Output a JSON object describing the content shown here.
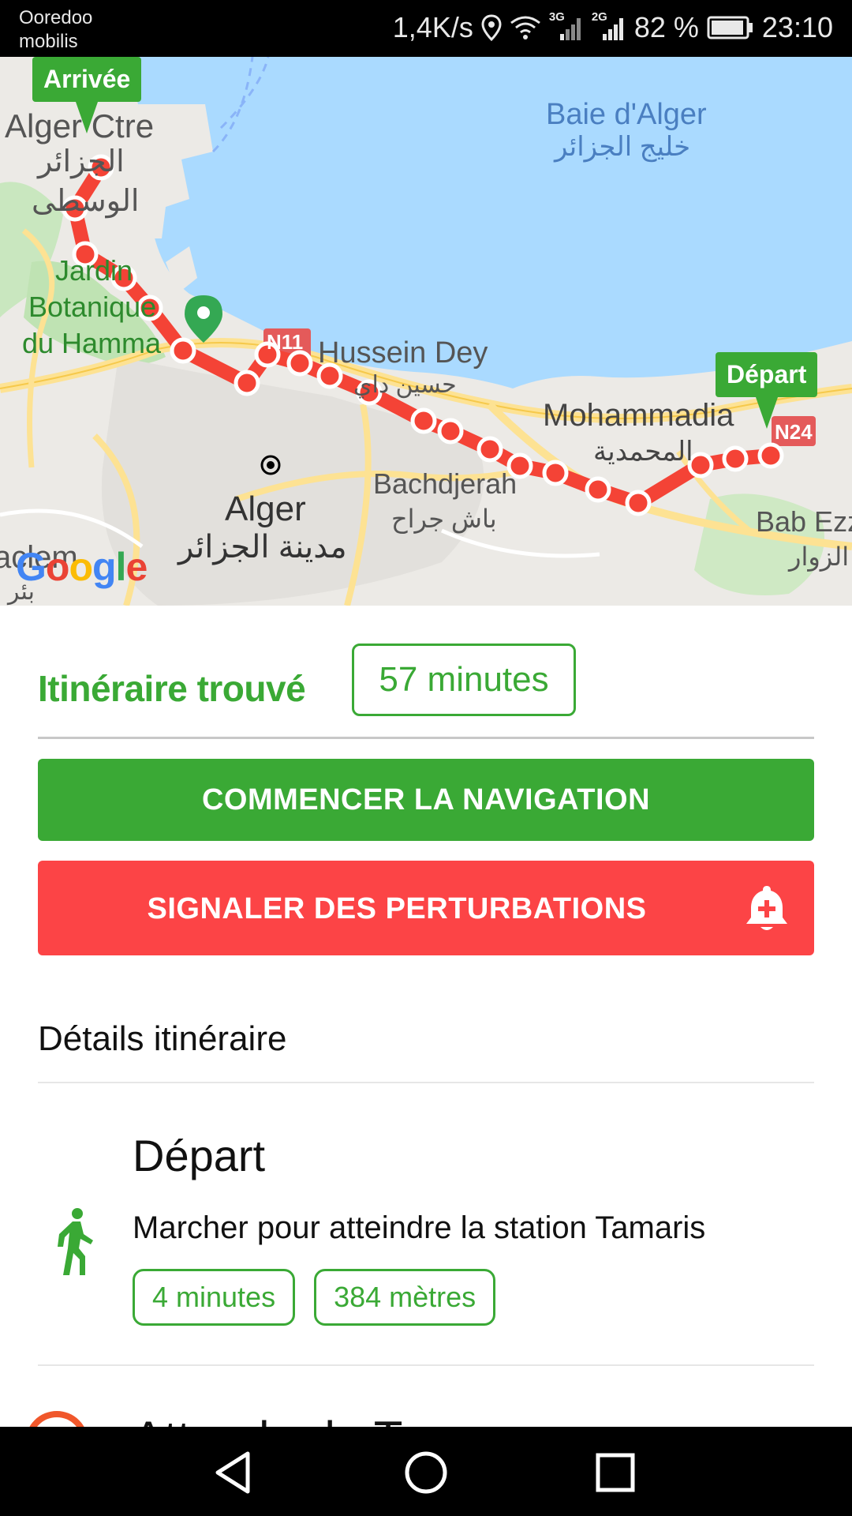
{
  "status_bar": {
    "carrier_line1": "Ooredoo",
    "carrier_line2": "mobilis",
    "network_speed": "1,4K/s",
    "signal_3g": "3G",
    "signal_2g": "2G",
    "battery": "82 %",
    "time": "23:10"
  },
  "map": {
    "marker_arrival": "Arrivée",
    "marker_departure": "Départ",
    "labels": {
      "alger_ctre": "Alger Ctre",
      "alger_ctre_ar1": "الجزائر",
      "alger_ctre_ar2": "الوسطى",
      "jardin1": "Jardin",
      "jardin2": "Botanique",
      "jardin3": "du Hamma",
      "baie": "Baie d'Alger",
      "baie_ar": "خليج الجزائر",
      "n11": "N11",
      "hussein": "Hussein Dey",
      "hussein_ar": "حسين داي",
      "mohammadia": "Mohammadia",
      "mohammadia_ar": "المحمدية",
      "n24": "N24",
      "bachdjerah": "Bachdjerah",
      "bachdjerah_ar": "باش جراح",
      "alger": "Alger",
      "alger_ar": "مدينة الجزائر",
      "bab_ezz": "Bab Ezz",
      "bab_ezz_ar": "الزوار",
      "left_edge": "aclem",
      "left_edge_ar": "بئر"
    },
    "logo": "Google"
  },
  "result": {
    "title": "Itinéraire trouvé",
    "duration": "57 minutes"
  },
  "actions": {
    "start_navigation": "COMMENCER LA NAVIGATION",
    "report_disruptions": "SIGNALER DES PERTURBATIONS"
  },
  "details": {
    "section_title": "Détails itinéraire",
    "steps": [
      {
        "title": "Départ",
        "description": "Marcher pour atteindre la station Tamaris",
        "time": "4 minutes",
        "distance": "384 mètres"
      },
      {
        "title": "Attendre le Tram"
      }
    ]
  },
  "colors": {
    "accent_green": "#3aa935",
    "alert_red": "#fc4446",
    "route_red": "#f44336",
    "water": "#aadaff"
  }
}
